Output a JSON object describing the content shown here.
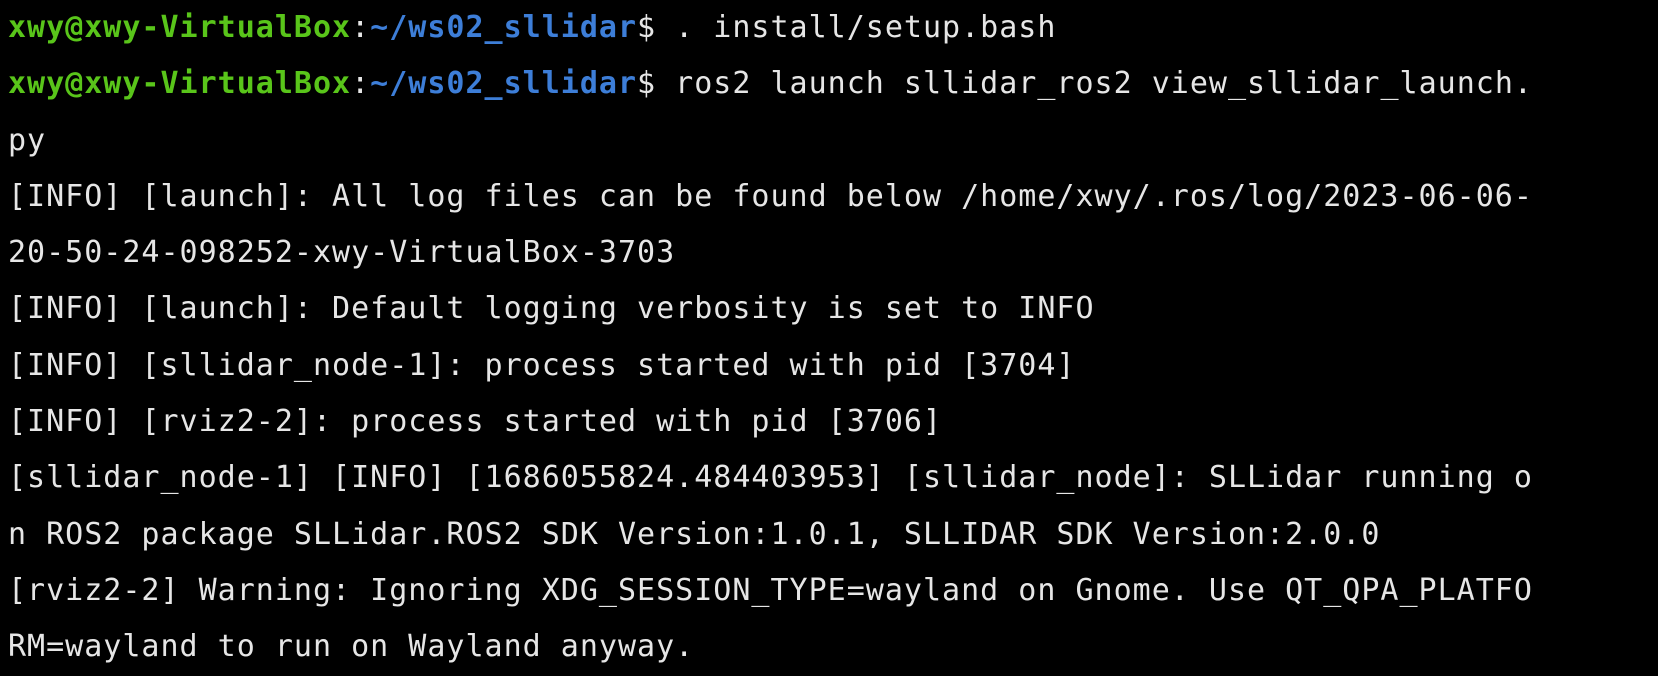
{
  "colors": {
    "background": "#000000",
    "text": "#e6e6e6",
    "user_host": "#59c51a",
    "path": "#3d7ed8"
  },
  "prompt": {
    "user_host": "xwy@xwy-VirtualBox",
    "separator": ":",
    "path": "~/ws02_sllidar",
    "symbol": "$"
  },
  "commands": [
    " . install/setup.bash",
    " ros2 launch sllidar_ros2 view_sllidar_launch."
  ],
  "output_lines": [
    "py",
    "[INFO] [launch]: All log files can be found below /home/xwy/.ros/log/2023-06-06-",
    "20-50-24-098252-xwy-VirtualBox-3703",
    "[INFO] [launch]: Default logging verbosity is set to INFO",
    "[INFO] [sllidar_node-1]: process started with pid [3704]",
    "[INFO] [rviz2-2]: process started with pid [3706]",
    "[sllidar_node-1] [INFO] [1686055824.484403953] [sllidar_node]: SLLidar running o",
    "n ROS2 package SLLidar.ROS2 SDK Version:1.0.1, SLLIDAR SDK Version:2.0.0",
    "[rviz2-2] Warning: Ignoring XDG_SESSION_TYPE=wayland on Gnome. Use QT_QPA_PLATFO",
    "RM=wayland to run on Wayland anyway."
  ]
}
